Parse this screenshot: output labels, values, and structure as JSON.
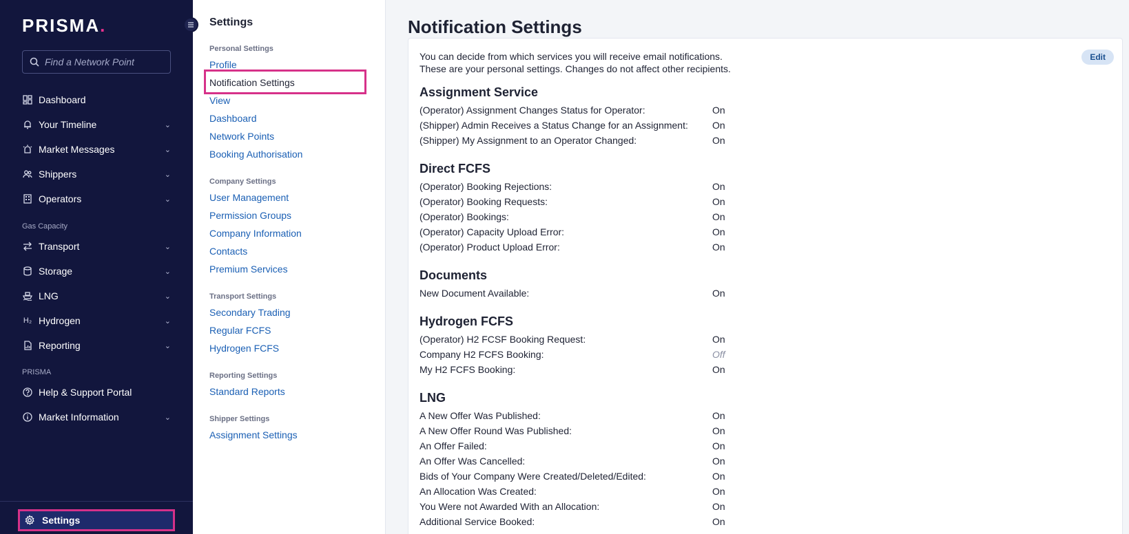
{
  "app": {
    "logo_text": "PRISMA",
    "logo_dot": "."
  },
  "search": {
    "placeholder": "Find a Network Point"
  },
  "sidebar": {
    "items_top": [
      {
        "label": "Dashboard",
        "icon": "dashboard-icon",
        "chevron": false
      },
      {
        "label": "Your Timeline",
        "icon": "bell-icon",
        "chevron": true
      },
      {
        "label": "Market Messages",
        "icon": "alarm-icon",
        "chevron": true
      },
      {
        "label": "Shippers",
        "icon": "users-icon",
        "chevron": true
      },
      {
        "label": "Operators",
        "icon": "building-icon",
        "chevron": true
      }
    ],
    "group_gas": "Gas Capacity",
    "items_gas": [
      {
        "label": "Transport",
        "icon": "transfer-icon",
        "chevron": true
      },
      {
        "label": "Storage",
        "icon": "database-icon",
        "chevron": true
      },
      {
        "label": "LNG",
        "icon": "ship-icon",
        "chevron": true
      },
      {
        "label": "Hydrogen",
        "icon": "h2-icon",
        "chevron": true
      },
      {
        "label": "Reporting",
        "icon": "report-icon",
        "chevron": true
      }
    ],
    "group_prisma": "PRISMA",
    "items_prisma": [
      {
        "label": "Help & Support Portal",
        "icon": "help-icon",
        "chevron": false
      },
      {
        "label": "Market Information",
        "icon": "info-icon",
        "chevron": true
      }
    ],
    "settings_label": "Settings",
    "h2_glyph": "H₂"
  },
  "menu": {
    "title": "Settings",
    "groups": [
      {
        "title": "Personal Settings",
        "links": [
          "Profile",
          "Notification Settings",
          "View",
          "Dashboard",
          "Network Points",
          "Booking Authorisation"
        ]
      },
      {
        "title": "Company Settings",
        "links": [
          "User Management",
          "Permission Groups",
          "Company Information",
          "Contacts",
          "Premium Services"
        ]
      },
      {
        "title": "Transport Settings",
        "links": [
          "Secondary Trading",
          "Regular FCFS",
          "Hydrogen FCFS"
        ]
      },
      {
        "title": "Reporting Settings",
        "links": [
          "Standard Reports"
        ]
      },
      {
        "title": "Shipper Settings",
        "links": [
          "Assignment Settings"
        ]
      }
    ],
    "active": "Notification Settings"
  },
  "main": {
    "title": "Notification Settings",
    "edit_label": "Edit",
    "intro_line1": "You can decide from which services you will receive email notifications.",
    "intro_line2": "These are your personal settings. Changes do not affect other recipients.",
    "sections": [
      {
        "title": "Assignment Service",
        "rows": [
          {
            "label": "(Operator) Assignment Changes Status for Operator:",
            "value": "On"
          },
          {
            "label": "(Shipper) Admin Receives a Status Change for an Assignment:",
            "value": "On"
          },
          {
            "label": "(Shipper) My Assignment to an Operator Changed:",
            "value": "On"
          }
        ]
      },
      {
        "title": "Direct FCFS",
        "rows": [
          {
            "label": "(Operator) Booking Rejections:",
            "value": "On"
          },
          {
            "label": "(Operator) Booking Requests:",
            "value": "On"
          },
          {
            "label": "(Operator) Bookings:",
            "value": "On"
          },
          {
            "label": "(Operator) Capacity Upload Error:",
            "value": "On"
          },
          {
            "label": "(Operator) Product Upload Error:",
            "value": "On"
          }
        ]
      },
      {
        "title": "Documents",
        "rows": [
          {
            "label": "New Document Available:",
            "value": "On"
          }
        ]
      },
      {
        "title": "Hydrogen FCFS",
        "rows": [
          {
            "label": "(Operator) H2 FCSF Booking Request:",
            "value": "On"
          },
          {
            "label": "Company H2 FCFS Booking:",
            "value": "Off"
          },
          {
            "label": "My H2 FCFS Booking:",
            "value": "On"
          }
        ]
      },
      {
        "title": "LNG",
        "rows": [
          {
            "label": "A New Offer Was Published:",
            "value": "On"
          },
          {
            "label": "A New Offer Round Was Published:",
            "value": "On"
          },
          {
            "label": "An Offer Failed:",
            "value": "On"
          },
          {
            "label": "An Offer Was Cancelled:",
            "value": "On"
          },
          {
            "label": "Bids of Your Company Were Created/Deleted/Edited:",
            "value": "On"
          },
          {
            "label": "An Allocation Was Created:",
            "value": "On"
          },
          {
            "label": "You Were not Awarded With an Allocation:",
            "value": "On"
          },
          {
            "label": "Additional Service Booked:",
            "value": "On"
          }
        ]
      }
    ]
  },
  "colors": {
    "sidebar_bg": "#12163d",
    "highlight": "#d63189",
    "link": "#1a5fb4",
    "logo_dot": "#e8318d"
  }
}
